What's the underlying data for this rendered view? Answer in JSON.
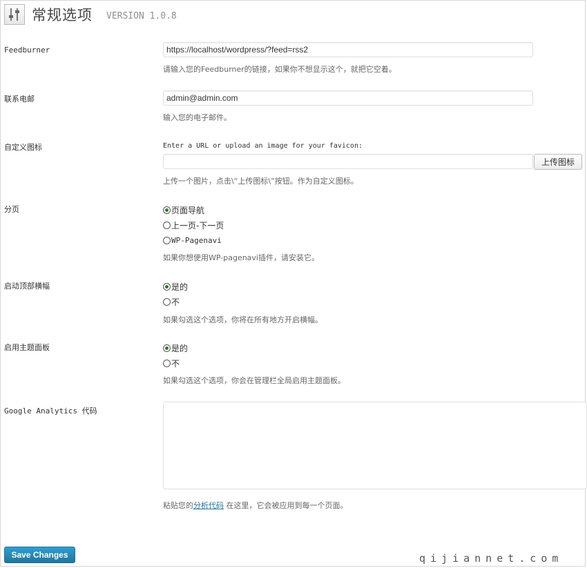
{
  "header": {
    "title": "常规选项",
    "version": "VERSION 1.0.8"
  },
  "feedburner": {
    "label": "Feedburner",
    "value": "https://localhost/wordpress/?feed=rss2",
    "desc": "请输入您的Feedburner的链接，如果你不想显示这个，就把它空着。"
  },
  "email": {
    "label": "联系电邮",
    "value": "admin@admin.com",
    "desc": "输入您的电子邮件。"
  },
  "favicon": {
    "label": "自定义图标",
    "note": "Enter a URL or upload an image for your favicon:",
    "value": "",
    "button": "上传图标",
    "desc": "上传一个图片，点击\\“上传图标\\”按钮。作为自定义图标。"
  },
  "pagination": {
    "label": "分页",
    "options": [
      "页面导航",
      "上一页-下一页",
      "WP-Pagenavi"
    ],
    "selected": 0,
    "desc": "如果你想使用WP-pagenavi插件，请安装它。"
  },
  "top_banner": {
    "label": "启动顶部横幅",
    "options": [
      "是的",
      "不"
    ],
    "selected": 0,
    "desc": "如果勾选这个选项，你将在所有地方开启横幅。"
  },
  "theme_panel": {
    "label": "启用主题面板",
    "options": [
      "是的",
      "不"
    ],
    "selected": 0,
    "desc": "如果勾选这个选项，你会在管理栏全局启用主题面板。"
  },
  "analytics": {
    "label": "Google Analytics 代码",
    "value": "",
    "desc_before": "粘贴您的",
    "desc_link": "分析代码",
    "desc_after": " 在这里，它会被应用到每一个页面。"
  },
  "footer": {
    "save_label": "Save Changes",
    "watermark": "qijiannet.com"
  },
  "colors": {
    "primary_button": "#21759b",
    "link": "#21759b",
    "radio_checked": "#2a7a2a"
  },
  "icons": {
    "app": "settings-sliders-icon"
  }
}
